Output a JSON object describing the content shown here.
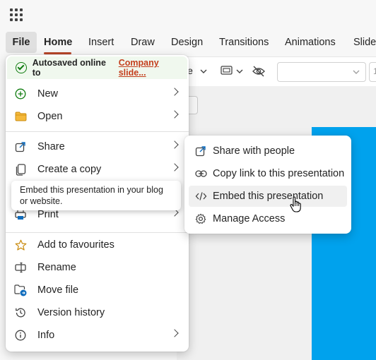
{
  "tabs": [
    {
      "label": "File"
    },
    {
      "label": "Home"
    },
    {
      "label": "Insert"
    },
    {
      "label": "Draw"
    },
    {
      "label": "Design"
    },
    {
      "label": "Transitions"
    },
    {
      "label": "Animations"
    },
    {
      "label": "Slide"
    }
  ],
  "toolbar": {
    "layout_fragment": "le",
    "font_size_fragment": "1"
  },
  "autosave": {
    "status": "Autosaved online to",
    "location": "Company slide..."
  },
  "menu_items": [
    {
      "label": "New",
      "icon": "plus-circle-icon"
    },
    {
      "label": "Open",
      "icon": "folder-icon"
    },
    {
      "label": "Share",
      "icon": "share-icon"
    },
    {
      "label": "Create a copy",
      "icon": "copy-icon"
    },
    {
      "label": "Print",
      "icon": "printer-icon"
    },
    {
      "label": "Add to favourites",
      "icon": "star-icon"
    },
    {
      "label": "Rename",
      "icon": "rename-icon"
    },
    {
      "label": "Move file",
      "icon": "move-folder-icon"
    },
    {
      "label": "Version history",
      "icon": "history-icon"
    },
    {
      "label": "Info",
      "icon": "info-icon"
    }
  ],
  "tooltip": "Embed this presentation in your blog or website.",
  "share_submenu": [
    {
      "label": "Share with people",
      "icon": "share-icon"
    },
    {
      "label": "Copy link to this presentation",
      "icon": "link-icon"
    },
    {
      "label": "Embed this presentation",
      "icon": "code-icon"
    },
    {
      "label": "Manage Access",
      "icon": "gear-icon"
    }
  ],
  "colors": {
    "accent": "#b7472a",
    "slide": "#00a2ed",
    "autosave_bg": "#f0f8ee",
    "link": "#c43e1c"
  }
}
